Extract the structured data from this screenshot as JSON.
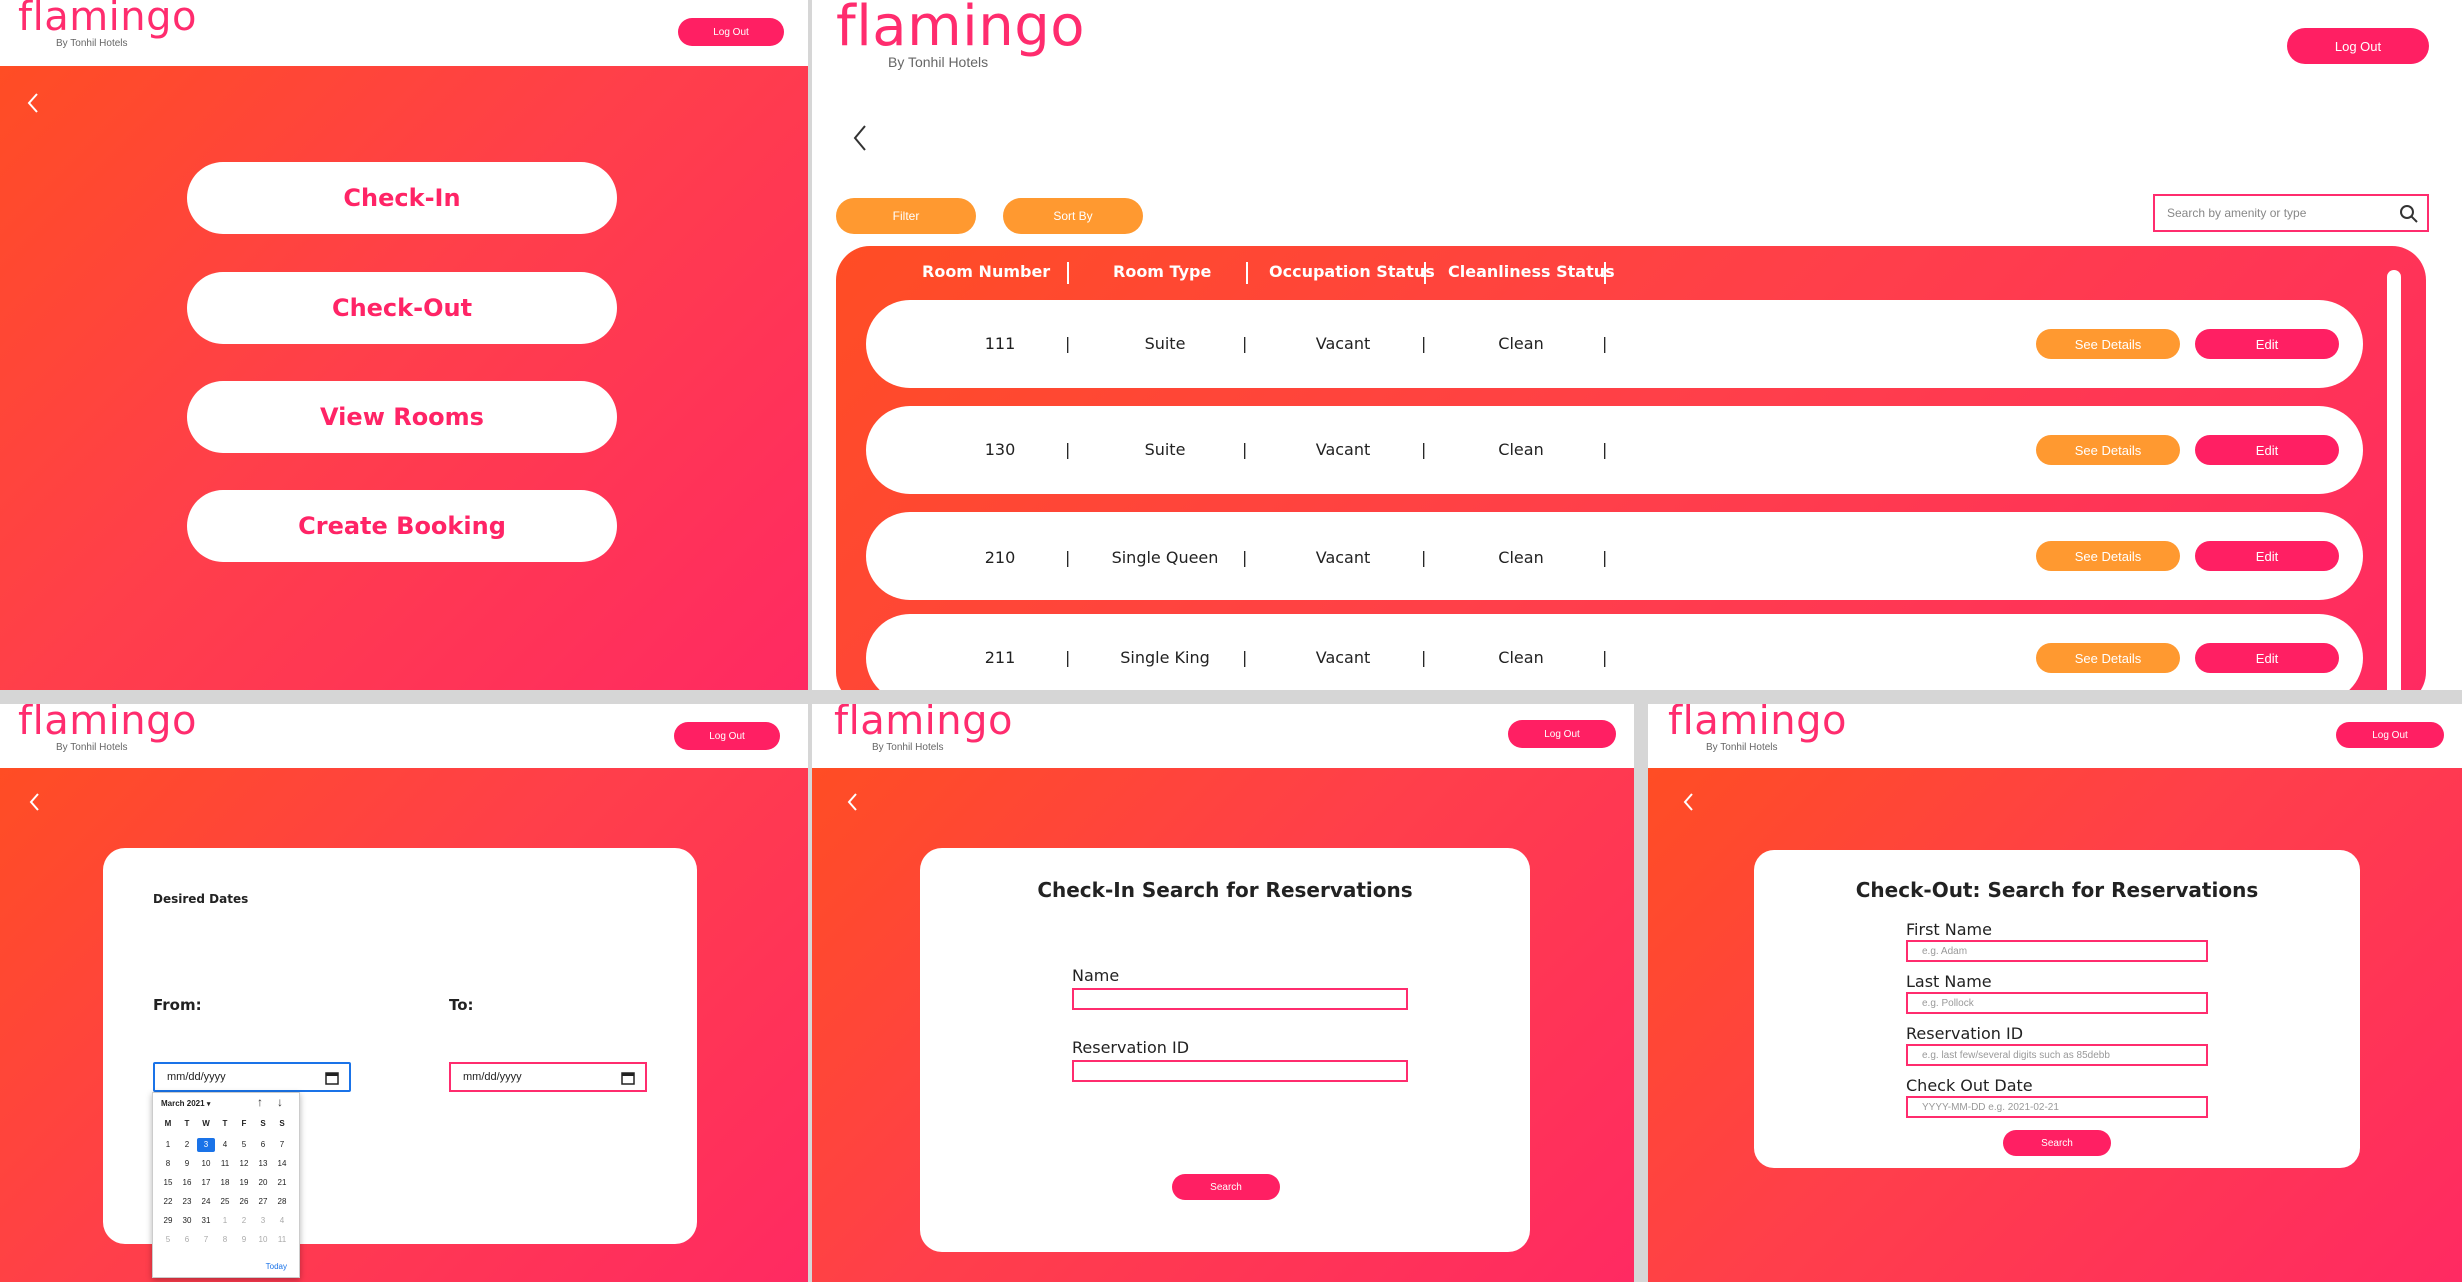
{
  "brand": {
    "name": "flamingo",
    "tagline": "By Tonhil Hotels",
    "pink": "#ff1f63",
    "orange": "#ff9930",
    "gradient_start": "#ff4d24",
    "gradient_end": "#ff2a62"
  },
  "common": {
    "logout_label": "Log Out",
    "back_icon": "chevron-left-icon"
  },
  "menu": {
    "buttons": [
      "Check-In",
      "Check-Out",
      "View Rooms",
      "Create Booking"
    ]
  },
  "rooms": {
    "filter_label": "Filter",
    "sort_label": "Sort By",
    "search_placeholder": "Search by amenity or type",
    "columns": [
      "Room Number",
      "Room Type",
      "Occupation Status",
      "Cleanliness Status"
    ],
    "rows": [
      {
        "number": "111",
        "type": "Suite",
        "occupation": "Vacant",
        "cleanliness": "Clean"
      },
      {
        "number": "130",
        "type": "Suite",
        "occupation": "Vacant",
        "cleanliness": "Clean"
      },
      {
        "number": "210",
        "type": "Single Queen",
        "occupation": "Vacant",
        "cleanliness": "Clean"
      },
      {
        "number": "211",
        "type": "Single King",
        "occupation": "Vacant",
        "cleanliness": "Clean"
      }
    ],
    "see_details_label": "See Details",
    "edit_label": "Edit",
    "separator": "|"
  },
  "booking": {
    "title": "Desired Dates",
    "from_label": "From:",
    "to_label": "To:",
    "from_value": "mm/dd/yyyy",
    "to_value": "mm/dd/yyyy",
    "calendar": {
      "month_label": "March 2021",
      "weekdays": [
        "M",
        "T",
        "W",
        "T",
        "F",
        "S",
        "S"
      ],
      "weeks": [
        [
          "1",
          "2",
          "3",
          "4",
          "5",
          "6",
          "7"
        ],
        [
          "8",
          "9",
          "10",
          "11",
          "12",
          "13",
          "14"
        ],
        [
          "15",
          "16",
          "17",
          "18",
          "19",
          "20",
          "21"
        ],
        [
          "22",
          "23",
          "24",
          "25",
          "26",
          "27",
          "28"
        ],
        [
          "29",
          "30",
          "31",
          "1",
          "2",
          "3",
          "4"
        ],
        [
          "5",
          "6",
          "7",
          "8",
          "9",
          "10",
          "11"
        ]
      ],
      "selected": "3",
      "today_label": "Today"
    }
  },
  "checkin": {
    "title": "Check-In Search for Reservations",
    "name_label": "Name",
    "reservation_label": "Reservation ID",
    "search_label": "Search"
  },
  "checkout": {
    "title": "Check-Out: Search for Reservations",
    "first_label": "First Name",
    "first_placeholder": "e.g. Adam",
    "last_label": "Last Name",
    "last_placeholder": "e.g. Pollock",
    "reservation_label": "Reservation ID",
    "reservation_placeholder": "e.g. last few/several digits such as 85debb",
    "date_label": "Check Out Date",
    "date_placeholder": "YYYY-MM-DD e.g. 2021-02-21",
    "search_label": "Search"
  }
}
